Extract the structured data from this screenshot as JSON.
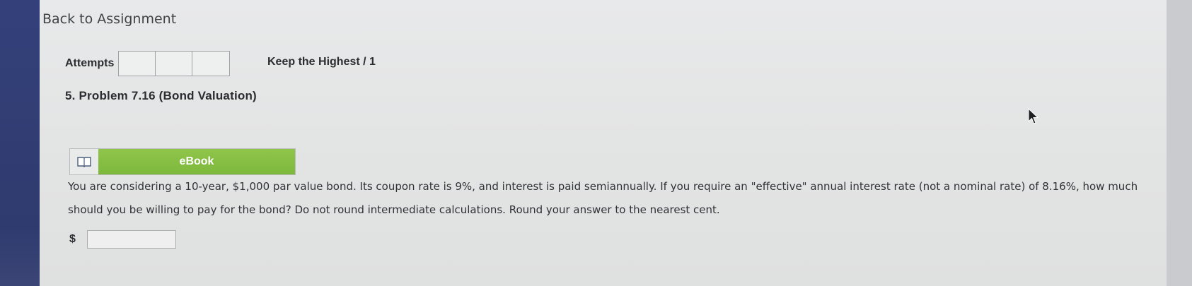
{
  "nav": {
    "back_label": "Back to Assignment"
  },
  "attempts": {
    "label": "Attempts",
    "boxes": [
      "",
      "",
      ""
    ],
    "keep_text": "Keep the Highest / 1"
  },
  "problem": {
    "title": "5.  Problem 7.16 (Bond Valuation)",
    "ebook_label": "eBook",
    "ebook_icon": "book-icon",
    "question": "You are considering a 10-year, $1,000 par value bond. Its coupon rate is 9%, and interest is paid semiannually. If you require an \"effective\" annual interest rate (not a nominal rate) of 8.16%, how much should you be willing to pay for the bond? Do not round intermediate calculations. Round your answer to the nearest cent.",
    "currency_symbol": "$",
    "answer_value": ""
  },
  "colors": {
    "ebook_green": "#7db83c",
    "page_bg": "#e3e4e4",
    "side_strip": "#2f3b6e"
  }
}
